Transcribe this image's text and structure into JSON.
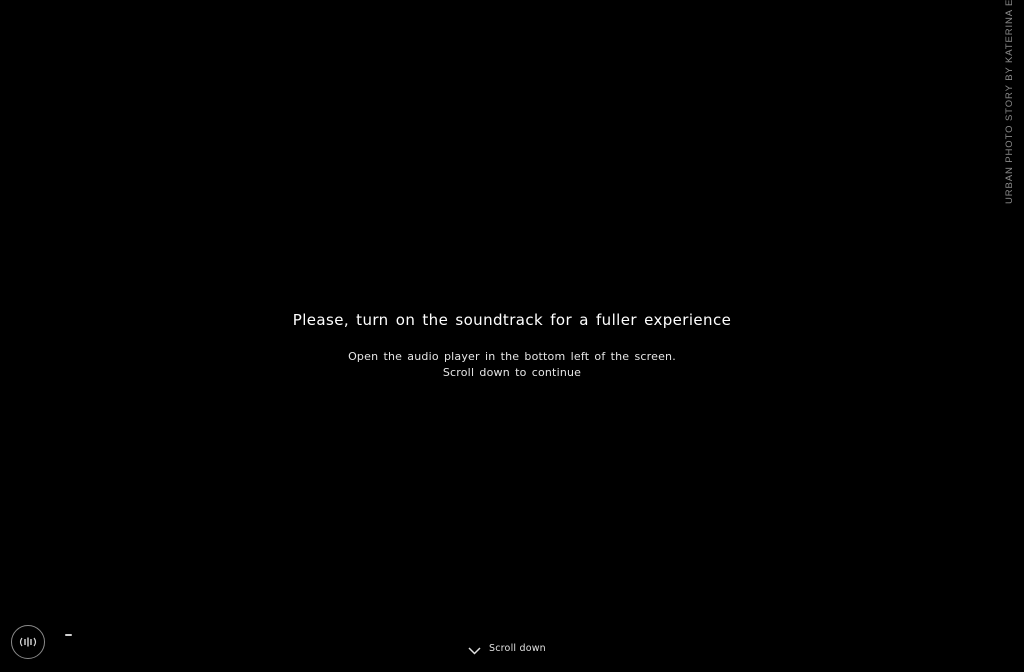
{
  "side_credit": "URBAN PHOTO STORY BY KATERINA ELIOR",
  "intro": {
    "headline": "Please, turn on the soundtrack for a fuller experience",
    "line1": "Open the audio player in the bottom left of the screen.",
    "line2": "Scroll down to continue"
  },
  "audio_player": {
    "icon": "audio-waves-icon"
  },
  "scroll_hint": {
    "label": "Scroll down",
    "icon": "chevron-down-icon"
  },
  "colors": {
    "background": "#000000",
    "text": "#ffffff",
    "muted": "#8a8a8a"
  }
}
